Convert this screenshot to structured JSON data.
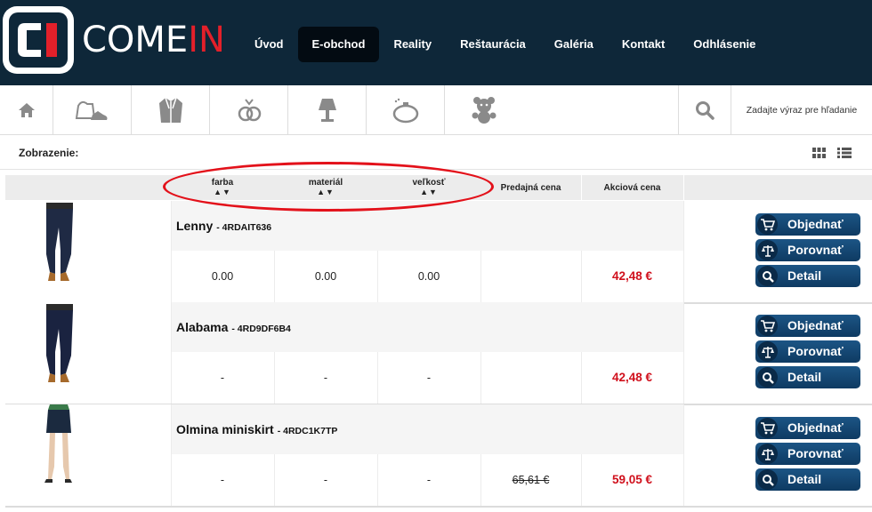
{
  "brand": {
    "word_main": "COME",
    "word_accent": "IN"
  },
  "nav": [
    {
      "label": "Úvod",
      "active": false
    },
    {
      "label": "E-obchod",
      "active": true
    },
    {
      "label": "Reality",
      "active": false
    },
    {
      "label": "Reštaurácia",
      "active": false
    },
    {
      "label": "Galéria",
      "active": false
    },
    {
      "label": "Kontakt",
      "active": false
    },
    {
      "label": "Odhlásenie",
      "active": false
    }
  ],
  "categories": [
    "home-icon",
    "shoes-bag-icon",
    "jacket-icon",
    "jewelry-icon",
    "lamp-icon",
    "perfume-icon",
    "teddy-bear-icon"
  ],
  "search": {
    "placeholder": "Zadajte výraz pre hľadanie"
  },
  "view": {
    "label": "Zobrazenie:"
  },
  "table": {
    "headers": {
      "farba": "farba",
      "material": "materiál",
      "velkost": "veľkosť",
      "predajna": "Predajná cena",
      "akciova": "Akciová cena"
    },
    "sort_arrows": "▲▼"
  },
  "products": [
    {
      "name": "Lenny",
      "code": "- 4RDAIT636",
      "farba": "0.00",
      "material": "0.00",
      "velkost": "0.00",
      "predajna": "",
      "akciova": "42,48 €",
      "image": "jeans-product-photo"
    },
    {
      "name": "Alabama",
      "code": "- 4RD9DF6B4",
      "farba": "-",
      "material": "-",
      "velkost": "-",
      "predajna": "",
      "akciova": "42,48 €",
      "image": "jeans-product-photo"
    },
    {
      "name": "Olmina miniskirt",
      "code": "- 4RDC1K7TP",
      "farba": "-",
      "material": "-",
      "velkost": "-",
      "predajna": "65,61 €",
      "akciova": "59,05 €",
      "image": "skirt-product-photo"
    }
  ],
  "actions": {
    "order": "Objednať",
    "compare": "Porovnať",
    "detail": "Detail"
  },
  "colors": {
    "header_bg": "#0e2739",
    "button": "#1c5585",
    "price": "#d0101c",
    "highlight_ellipse": "#e3111a"
  }
}
